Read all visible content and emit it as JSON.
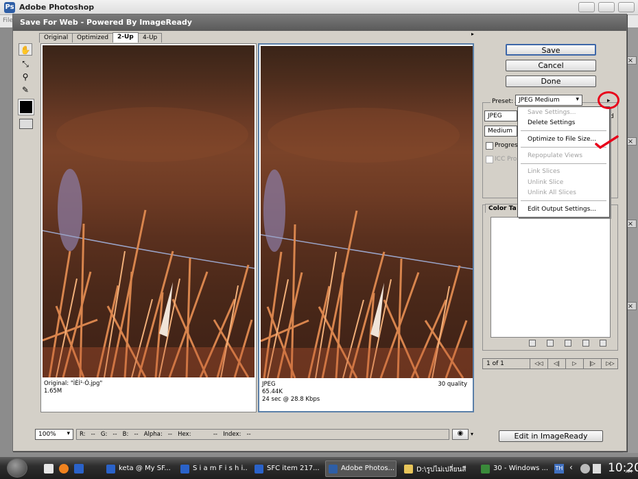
{
  "app": {
    "title": "Adobe Photoshop",
    "menu_fragment": "File"
  },
  "dialog": {
    "title": "Save For Web - Powered By ImageReady",
    "tabs": [
      {
        "label": "Original"
      },
      {
        "label": "Optimized"
      },
      {
        "label": "2-Up"
      },
      {
        "label": "4-Up"
      }
    ],
    "panes": {
      "left": {
        "line1": "Original: \"ÌÈÌ¹·Ó.jpg\"",
        "line2": "1.65M"
      },
      "right": {
        "line1": "JPEG",
        "line2": "65.44K",
        "line3": "24 sec @ 28.8 Kbps",
        "quality": "30 quality"
      }
    },
    "buttons": {
      "save": "Save",
      "cancel": "Cancel",
      "done": "Done",
      "edit_imageready": "Edit in ImageReady"
    },
    "settings": {
      "preset_label": "Preset:",
      "preset_value": "JPEG Medium",
      "format_value": "JPEG",
      "quality_value": "Medium",
      "progressive_label": "Progress",
      "icc_label": "ICC Pro",
      "right_fragment": "d"
    },
    "color_table": {
      "tab_label": "Color Ta"
    },
    "navigator": {
      "page": "1 of 1",
      "first": "◁◁",
      "prev": "◁|",
      "play": "▷",
      "next": "|▷",
      "last": "▷▷"
    },
    "flyout_menu": {
      "items": [
        {
          "label": "Save Settings...",
          "disabled": true
        },
        {
          "label": "Delete Settings",
          "disabled": false
        },
        {
          "label": "Optimize to File Size...",
          "disabled": false
        },
        {
          "label": "Repopulate Views",
          "disabled": true
        },
        {
          "label": "Link Slices",
          "disabled": true
        },
        {
          "label": "Unlink Slice",
          "disabled": true
        },
        {
          "label": "Unlink All Slices",
          "disabled": true
        },
        {
          "label": "Edit Output Settings...",
          "disabled": false
        }
      ]
    },
    "status": {
      "zoom": "100%",
      "readout": "R:   --   G:   --   B:   --   Alpha:   --   Hex:            --   Index:   --"
    }
  },
  "taskbar": {
    "items": [
      {
        "label": "keta @ My SF...",
        "icon_color": "#2a62c9"
      },
      {
        "label": "S i a m F i s h i...",
        "icon_color": "#2a62c9"
      },
      {
        "label": "SFC item 217...",
        "icon_color": "#2a62c9"
      },
      {
        "label": "Adobe Photos...",
        "icon_color": "#2e5ea6",
        "active": true
      },
      {
        "label": "D:\\รูปไม่เปลี่ยนสี",
        "icon_color": "#e8c55a"
      },
      {
        "label": "30 - Windows ...",
        "icon_color": "#3a8a3a"
      }
    ],
    "clock": "10:20",
    "clock_ampm": "AM"
  },
  "colors": {
    "annotation": "#e8001a",
    "dialog_bg": "#d4d0c8",
    "title_gray": "#6a6a6a"
  }
}
